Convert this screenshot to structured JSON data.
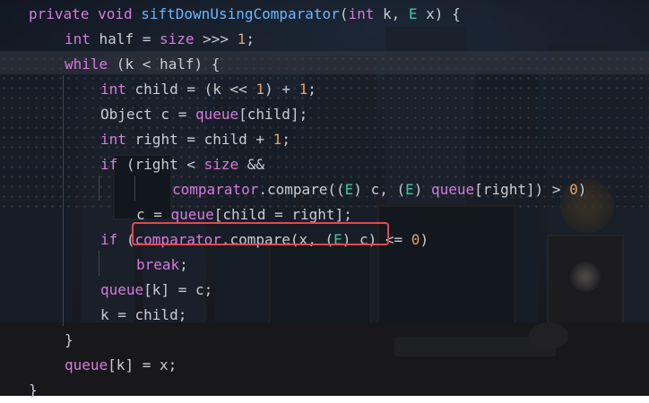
{
  "code": {
    "lines": [
      {
        "indent": 0,
        "tokens": [
          [
            "kw",
            "private"
          ],
          [
            "p",
            " "
          ],
          [
            "kw",
            "void"
          ],
          [
            "p",
            " "
          ],
          [
            "fn",
            "siftDownUsingComparator"
          ],
          [
            "p",
            "("
          ],
          [
            "kw",
            "int"
          ],
          [
            "p",
            " k, "
          ],
          [
            "gen",
            "E"
          ],
          [
            "p",
            " x) {"
          ]
        ]
      },
      {
        "indent": 1,
        "tokens": [
          [
            "kw",
            "int"
          ],
          [
            "p",
            " half = "
          ],
          [
            "fld",
            "size"
          ],
          [
            "p",
            " >>> "
          ],
          [
            "num",
            "1"
          ],
          [
            "p",
            ";"
          ]
        ]
      },
      {
        "indent": 1,
        "tokens": [
          [
            "kw",
            "while"
          ],
          [
            "p",
            " (k < half) {"
          ]
        ]
      },
      {
        "indent": 2,
        "tokens": [
          [
            "kw",
            "int"
          ],
          [
            "p",
            " child = (k << "
          ],
          [
            "num",
            "1"
          ],
          [
            "p",
            ") + "
          ],
          [
            "num",
            "1"
          ],
          [
            "p",
            ";"
          ]
        ]
      },
      {
        "indent": 2,
        "tokens": [
          [
            "p",
            "Object c = "
          ],
          [
            "fld",
            "queue"
          ],
          [
            "p",
            "[child];"
          ]
        ]
      },
      {
        "indent": 2,
        "tokens": [
          [
            "kw",
            "int"
          ],
          [
            "p",
            " right = child + "
          ],
          [
            "num",
            "1"
          ],
          [
            "p",
            ";"
          ]
        ]
      },
      {
        "indent": 2,
        "tokens": [
          [
            "kw",
            "if"
          ],
          [
            "p",
            " (right < "
          ],
          [
            "fld",
            "size"
          ],
          [
            "p",
            " &&"
          ]
        ]
      },
      {
        "indent": 4,
        "tokens": [
          [
            "fld",
            "comparator"
          ],
          [
            "p",
            ".compare(("
          ],
          [
            "gen",
            "E"
          ],
          [
            "p",
            ") c, ("
          ],
          [
            "gen",
            "E"
          ],
          [
            "p",
            ") "
          ],
          [
            "fld",
            "queue"
          ],
          [
            "p",
            "[right]) > "
          ],
          [
            "num",
            "0"
          ],
          [
            "p",
            ")"
          ]
        ]
      },
      {
        "indent": 3,
        "tokens": [
          [
            "p",
            "c = "
          ],
          [
            "fld",
            "queue"
          ],
          [
            "p",
            "[child = right];"
          ]
        ]
      },
      {
        "indent": 2,
        "tokens": [
          [
            "kw",
            "if"
          ],
          [
            "p",
            " ("
          ],
          [
            "fld",
            "comparator"
          ],
          [
            "p",
            ".compare(x, ("
          ],
          [
            "gen",
            "E"
          ],
          [
            "p",
            ") c) <= "
          ],
          [
            "num",
            "0"
          ],
          [
            "p",
            ")"
          ]
        ]
      },
      {
        "indent": 3,
        "tokens": [
          [
            "kw",
            "break"
          ],
          [
            "p",
            ";"
          ]
        ]
      },
      {
        "indent": 2,
        "tokens": [
          [
            "fld",
            "queue"
          ],
          [
            "p",
            "[k] = c;"
          ]
        ]
      },
      {
        "indent": 2,
        "tokens": [
          [
            "p",
            "k = child;"
          ]
        ]
      },
      {
        "indent": 1,
        "tokens": [
          [
            "p",
            "}"
          ]
        ]
      },
      {
        "indent": 1,
        "tokens": [
          [
            "fld",
            "queue"
          ],
          [
            "p",
            "[k] = x;"
          ]
        ]
      },
      {
        "indent": 0,
        "tokens": [
          [
            "p",
            "}"
          ]
        ]
      }
    ]
  },
  "colors": {
    "keyword": "#d77bde",
    "function": "#6cb6ff",
    "number": "#e8a070",
    "generic": "#3fc4a6",
    "text": "#c8ccd4",
    "highlight_box": "#e0494f"
  }
}
